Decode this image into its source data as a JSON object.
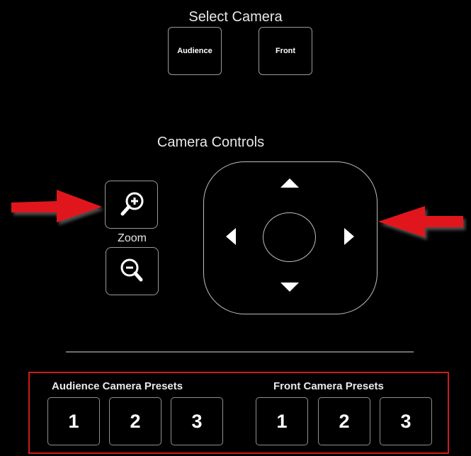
{
  "select_camera": {
    "title": "Select Camera",
    "buttons": [
      "Audience",
      "Front"
    ]
  },
  "camera_controls": {
    "title": "Camera Controls",
    "zoom_label": "Zoom"
  },
  "presets": {
    "audience_label": "Audience Camera Presets",
    "front_label": "Front Camera Presets",
    "audience_buttons": [
      "1",
      "2",
      "3"
    ],
    "front_buttons": [
      "1",
      "2",
      "3"
    ]
  },
  "colors": {
    "background": "#000000",
    "border": "#9a9a9a",
    "highlight_red": "#d11a1a",
    "annotation_arrow": "#e0151b"
  },
  "icons": {
    "zoom_in": "zoom-in-magnifier-icon",
    "zoom_out": "zoom-out-magnifier-icon",
    "pan_up": "triangle-up-icon",
    "pan_down": "triangle-down-icon",
    "pan_left": "triangle-left-icon",
    "pan_right": "triangle-right-icon",
    "annotation": "red-pointer-arrow-icon"
  }
}
